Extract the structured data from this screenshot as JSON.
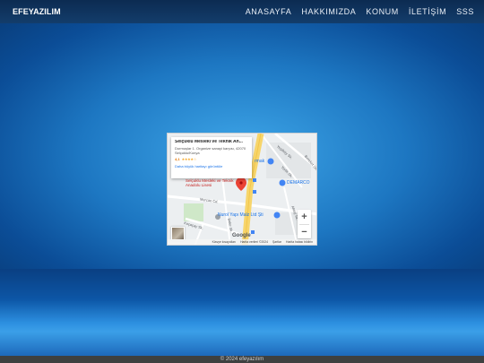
{
  "header": {
    "brand": "EFEYAZILIM",
    "nav": [
      "ANASAYFA",
      "HAKKIMIZDA",
      "KONUM",
      "İLETİŞİM",
      "SSS"
    ]
  },
  "map": {
    "place_title": "Selçuklu Mesleki ve Teknik An...",
    "address": "Durmuşlar 1. Organize sanayi karşısı, 42070 Selçuklu/Konya",
    "rating_value": "4,1",
    "rating_stars": "★★★★☆",
    "view_larger_link": "Daha büyük haritayı görüntüle",
    "marker_label": "Selçuklu Mesleki ve Teknik Anadolu Lisesi",
    "poi_demarco": "DEMARCO",
    "poi_nurol": "Nurol Yapı Malz Ltd Şti",
    "poi_hmark": "rmak",
    "street_mercan": "Mercan Cd.",
    "street_kocacay": "Koçaçay Sk.",
    "street_yesilkoy": "Yeşilköy Sk.",
    "street_bereket": "Bereket Sk.",
    "street_yerlik": "Yerlik Sk.",
    "street_bakir": "Bakır Sk.",
    "street_aktas": "Aktaş Sk.",
    "zoom_in": "+",
    "zoom_out": "−",
    "google": "Google",
    "attribution": {
      "shortcuts": "Klavye kısayolları",
      "mapdata": "Harita verileri ©2024",
      "terms": "Şartlar",
      "report": "Harita hatası bildirin"
    }
  },
  "footer": {
    "text": "© 2024 efeyazılım"
  },
  "colors": {
    "accent": "#1a73e8",
    "marker": "#ea4335",
    "road_yellow": "#f7d56b",
    "bg_blue": "#1d77c2"
  }
}
